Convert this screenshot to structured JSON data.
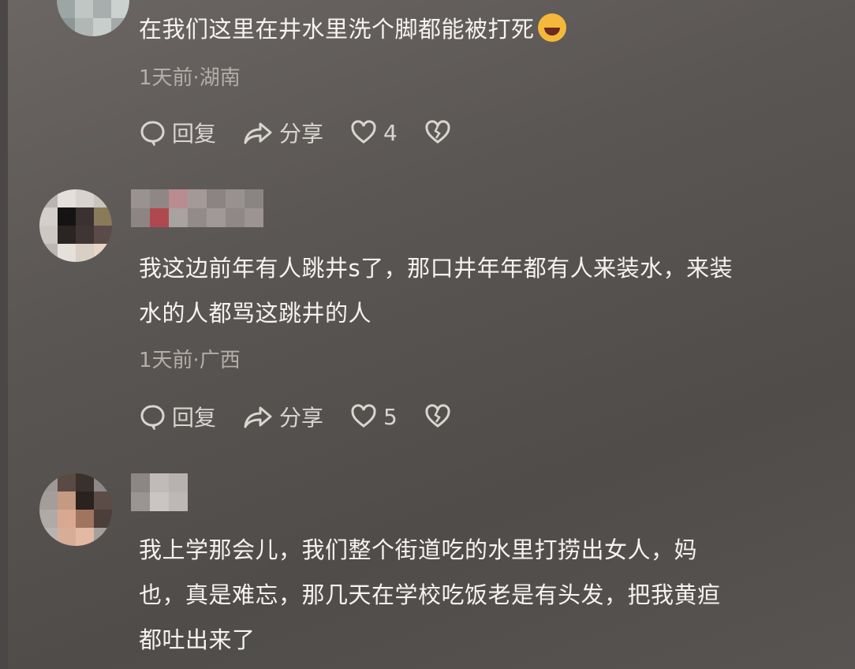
{
  "comments": [
    {
      "text_lines": [
        "在我们这里在井水里洗个脚都能被打死"
      ],
      "emoji": "rolling-on-floor-laughing",
      "meta": "1天前·湖南",
      "reply": "回复",
      "share": "分享",
      "likes": "4"
    },
    {
      "text_lines": [
        "我这边前年有人跳井s了，那口井年年都有人来装水，来装",
        "水的人都骂这跳井的人"
      ],
      "meta": "1天前·广西",
      "reply": "回复",
      "share": "分享",
      "likes": "5"
    },
    {
      "text_lines": [
        "我上学那会儿，我们整个街道吃的水里打捞出女人，妈",
        "也，真是难忘，那几天在学校吃饭老是有头发，把我黄疸",
        "都吐出来了"
      ]
    }
  ],
  "colors": {
    "background": "#5a5654",
    "text": "#f5f3f1",
    "meta": "#b3aeaa",
    "emoji": "#f4b93a"
  }
}
